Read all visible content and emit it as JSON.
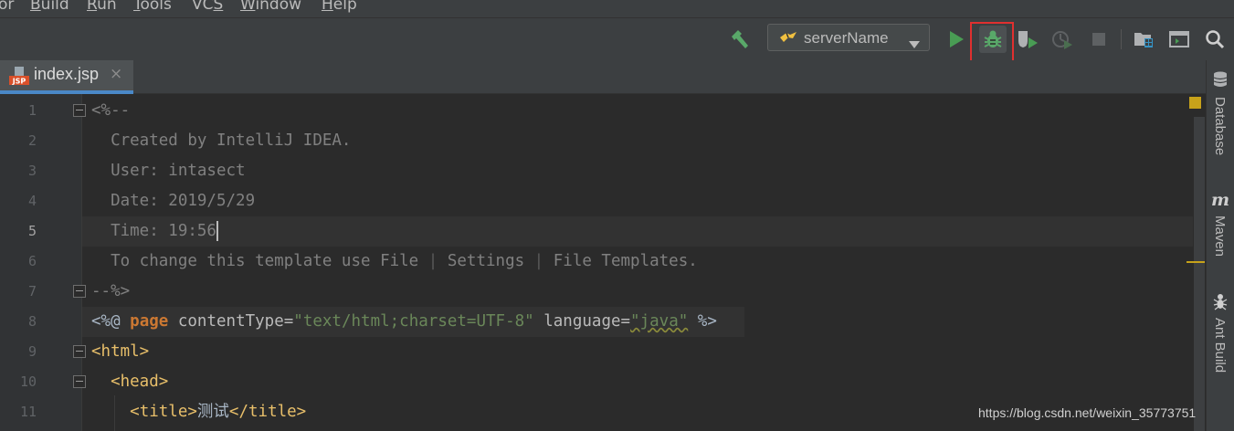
{
  "menu": {
    "items": [
      {
        "label": "or",
        "underline": ""
      },
      {
        "label": "Build",
        "underline": "B"
      },
      {
        "label": "Run",
        "underline": "R"
      },
      {
        "label": "Tools",
        "underline": "T"
      },
      {
        "label": "VCS",
        "underline": "S"
      },
      {
        "label": "Window",
        "underline": "W"
      },
      {
        "label": "Help",
        "underline": "H"
      }
    ]
  },
  "toolbar": {
    "build_icon": "hammer-icon",
    "run_config": {
      "label": "serverName"
    },
    "run_icon": "run-icon",
    "debug_icon": "debug-bug-icon",
    "coverage_icon": "run-with-coverage-icon",
    "profile_icon": "profile-icon",
    "stop_icon": "stop-icon",
    "project_structure_icon": "project-structure-icon",
    "terminal_icon": "terminal-icon",
    "search_icon": "search-icon",
    "highlight_color": "#e0302f"
  },
  "tab": {
    "label": "index.jsp",
    "close": "×",
    "icon_text": "JSP"
  },
  "gutter": {
    "line_numbers": [
      "1",
      "2",
      "3",
      "4",
      "5",
      "6",
      "7",
      "8",
      "9",
      "10",
      "11"
    ]
  },
  "code": {
    "line1": {
      "text": "<%--"
    },
    "line2": {
      "text": "  Created by IntelliJ IDEA."
    },
    "line3": {
      "text": "  User: intasect"
    },
    "line4": {
      "text": "  Date: 2019/5/29"
    },
    "line5": {
      "text": "  Time: 19:56"
    },
    "line6": {
      "a": "  To change this template use File ",
      "p1": "|",
      "b": " Settings ",
      "p2": "|",
      "c": " File Templates."
    },
    "line7": {
      "text": "--%>"
    },
    "line8": {
      "open": "<%@ ",
      "kw": "page",
      "attr1": " contentType=",
      "val1": "\"text/html;charset=UTF-8\"",
      "attr2": " language=",
      "val2": "\"java\"",
      "close": " %>"
    },
    "line9": {
      "tag": "<html>"
    },
    "line10": {
      "indent": "  ",
      "tag": "<head>"
    },
    "line11": {
      "indent": "    ",
      "open": "<title>",
      "text": "测试",
      "close": "</title>"
    }
  },
  "rightbar": {
    "database": "Database",
    "maven": "Maven",
    "ant": "Ant Build"
  },
  "watermark": "https://blog.csdn.net/weixin_35773751"
}
